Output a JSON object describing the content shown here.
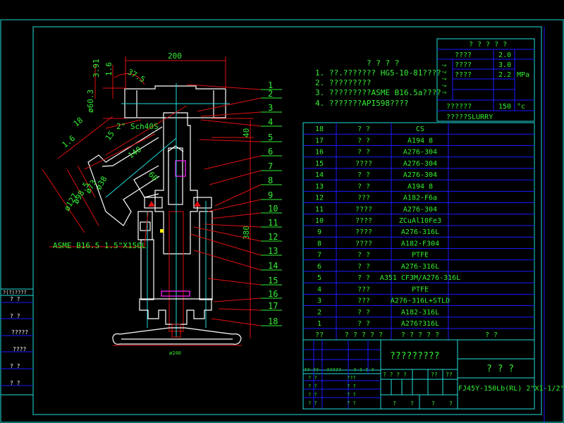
{
  "drawing": {
    "dimensions": {
      "top_width": "200",
      "d391": "3.91",
      "d16a": "1.6",
      "angle": "37.5",
      "dia603": "ø60.3",
      "pipe": "2\" Sch40S",
      "d18": "18",
      "d16b": "1.6",
      "d15": "15",
      "d140": "140",
      "d60": "60",
      "d38": "ø38",
      "d73": "ø73",
      "d985": "ø98.5",
      "d127": "ø127",
      "flange": "ASME B16.5  1.5\"X150L",
      "h40": "40",
      "h380": "380",
      "d240": "ø240"
    },
    "balloons": [
      "1",
      "2",
      "3",
      "4",
      "5",
      "6",
      "7",
      "8",
      "9",
      "10",
      "11",
      "12",
      "13",
      "14",
      "15",
      "16",
      "17",
      "18"
    ]
  },
  "notes": {
    "title": "? ? ? ?",
    "items": [
      "1. ??.??????? HG5-10-81????",
      "2. ?????????",
      "3. ?????????ASME B16.5a????",
      "4. ???????API598????"
    ]
  },
  "spec_table": {
    "title": "? ? ? ? ?",
    "row1_label": "????",
    "row1_value": "2.0",
    "side_label": "? ? ? ? ?",
    "row2_label": "????",
    "row2_value": "3.0",
    "row3_label": "????",
    "row3_value": "2.2",
    "unit_pressure": "MPa",
    "temp_label": "??????",
    "temp_value": "150",
    "temp_unit": "°c",
    "medium": "?????SLURRY"
  },
  "parts_table": {
    "rows": [
      {
        "no": "18",
        "name": "?  ?",
        "material": "CS"
      },
      {
        "no": "17",
        "name": "?  ?",
        "material": "A194 8"
      },
      {
        "no": "16",
        "name": "?  ?",
        "material": "A276-304"
      },
      {
        "no": "15",
        "name": "????",
        "material": "A276-304"
      },
      {
        "no": "14",
        "name": "?  ?",
        "material": "A276-304"
      },
      {
        "no": "13",
        "name": "?  ?",
        "material": "A194 8"
      },
      {
        "no": "12",
        "name": "???",
        "material": "A182-F6a"
      },
      {
        "no": "11",
        "name": "????",
        "material": "A276-304"
      },
      {
        "no": "10",
        "name": "????",
        "material": "ZCuAl10Fe3"
      },
      {
        "no": "9",
        "name": "????",
        "material": "A276-316L"
      },
      {
        "no": "8",
        "name": "????",
        "material": "A182-F304"
      },
      {
        "no": "7",
        "name": "?  ?",
        "material": "PTFE"
      },
      {
        "no": "6",
        "name": "?  ?",
        "material": "A276-316L"
      },
      {
        "no": "5",
        "name": "?  ?",
        "material": "A351 CF3M/A276-316L"
      },
      {
        "no": "4",
        "name": "???",
        "material": "PTFE"
      },
      {
        "no": "3",
        "name": "???",
        "material": "A276-316L+STLD"
      },
      {
        "no": "2",
        "name": "?  ?",
        "material": "A182-316L"
      },
      {
        "no": "1",
        "name": "?  ?",
        "material": "A276?316L"
      }
    ],
    "header": {
      "no": "??",
      "name": "? ? ? ? ?",
      "material": "? ? ? ? ?",
      "remark": "?     ?"
    }
  },
  "title_block": {
    "drawing_name": "?????????",
    "company": "? ? ?",
    "model": "FJ45Y-150Lb(RL) 2\"X1-1/2\"",
    "sign_header": [
      "?? ??",
      "?????",
      "? ? ? ?"
    ],
    "sign_rows": [
      [
        "? ?",
        "???"
      ],
      [
        "? ?",
        "?  ?"
      ],
      [
        "? ?",
        "? ?"
      ],
      [
        "? ?",
        "? ?"
      ]
    ],
    "stage_label": "? ? ? ?",
    "weight_label": "??",
    "scale_label": "??",
    "bottom": [
      "?",
      "?",
      "?",
      "?"
    ]
  },
  "left_strip": {
    "header": "?(?)????",
    "items": [
      "?  ?",
      "?  ?",
      "?????",
      "????",
      "?  ?",
      "?  ?"
    ]
  },
  "colors": {
    "frame": "#22dddd",
    "grid": "#1a1aff",
    "text": "#33ee33",
    "dimension": "#e01010",
    "outline": "#ffffff",
    "seal": "#e020e0"
  }
}
